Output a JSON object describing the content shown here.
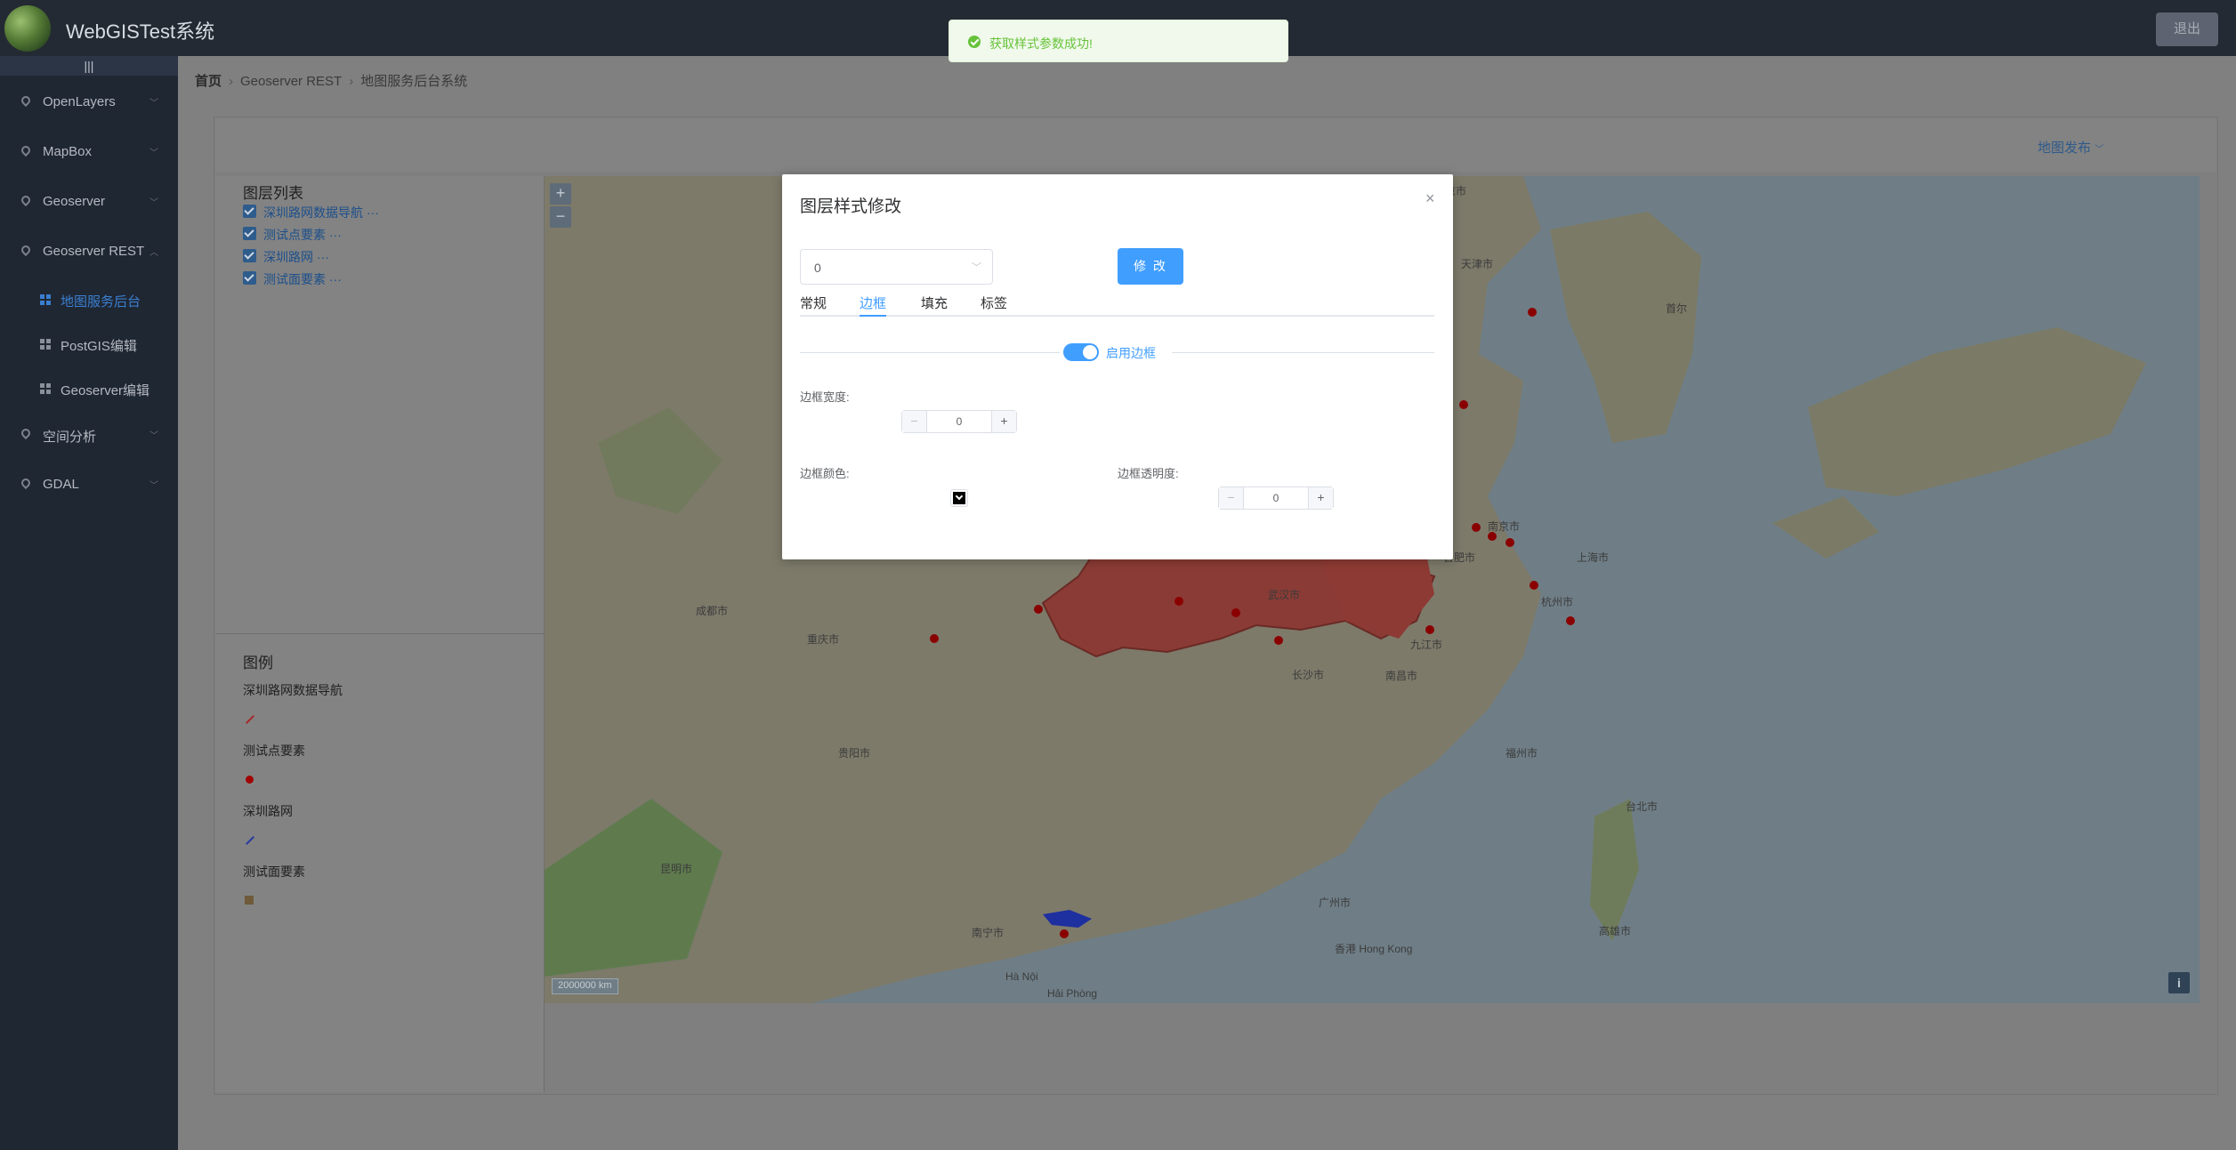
{
  "app": {
    "title": "WebGISTest系统",
    "logout_label": "退出",
    "collapse_glyph": "|||"
  },
  "sidebar": {
    "items": [
      {
        "label": "OpenLayers"
      },
      {
        "label": "MapBox"
      },
      {
        "label": "Geoserver"
      },
      {
        "label": "Geoserver REST"
      },
      {
        "label": "空间分析"
      },
      {
        "label": "GDAL"
      }
    ],
    "sub_items": [
      {
        "label": "地图服务后台",
        "active": true
      },
      {
        "label": "PostGIS编辑"
      },
      {
        "label": "Geoserver编辑"
      }
    ]
  },
  "breadcrumb": {
    "home": "首页",
    "section": "Geoserver REST",
    "page": "地图服务后台系统"
  },
  "toolbar": {
    "publish_label": "地图发布"
  },
  "layer_panel": {
    "title": "图层列表",
    "layers": [
      {
        "name": "深圳路网数据导航"
      },
      {
        "name": "测试点要素"
      },
      {
        "name": "深圳路网"
      },
      {
        "name": "测试面要素"
      }
    ],
    "more_glyph": "···"
  },
  "legend": {
    "title": "图例",
    "items": [
      {
        "name": "深圳路网数据导航",
        "color": "#a52a2a"
      },
      {
        "name": "测试点要素",
        "color": "#a00000"
      },
      {
        "name": "深圳路网",
        "color": "#2a3aa0"
      },
      {
        "name": "测试面要素",
        "color": "#6f5a3a"
      }
    ]
  },
  "map": {
    "zoom_in": "+",
    "zoom_out": "−",
    "scale_text": "2000000 km",
    "info_label": "i",
    "city_labels": [
      "武汉市",
      "九江市",
      "南昌市",
      "长沙市",
      "上海市",
      "杭州市",
      "南京市",
      "合肥市",
      "福州市",
      "广州市",
      "香港 Hong Kong",
      "成都市",
      "重庆市",
      "昆明市",
      "贵阳市",
      "南宁市",
      "北京市",
      "天津市",
      "首尔",
      "台北市",
      "高雄市",
      "Hà Nội",
      "Hải Phòng"
    ]
  },
  "dialog": {
    "title": "图层样式修改",
    "close_glyph": "×",
    "select_value": "0",
    "modify_label": "修 改",
    "tabs": [
      {
        "label": "常规"
      },
      {
        "label": "边框",
        "active": true
      },
      {
        "label": "填充"
      },
      {
        "label": "标签"
      }
    ],
    "border_enabled_label": "启用边框",
    "border_width_label": "边框宽度:",
    "border_width_value": "0",
    "border_color_label": "边框颜色:",
    "border_color": "#000000",
    "border_opacity_label": "边框透明度:",
    "border_opacity_value": "0",
    "stepper_minus": "−",
    "stepper_plus": "+"
  },
  "toast": {
    "message": "获取样式参数成功!"
  },
  "colors": {
    "accent": "#409eff",
    "success": "#67c23a",
    "sidebar_bg": "#1f2733",
    "header_bg": "#242a33"
  }
}
